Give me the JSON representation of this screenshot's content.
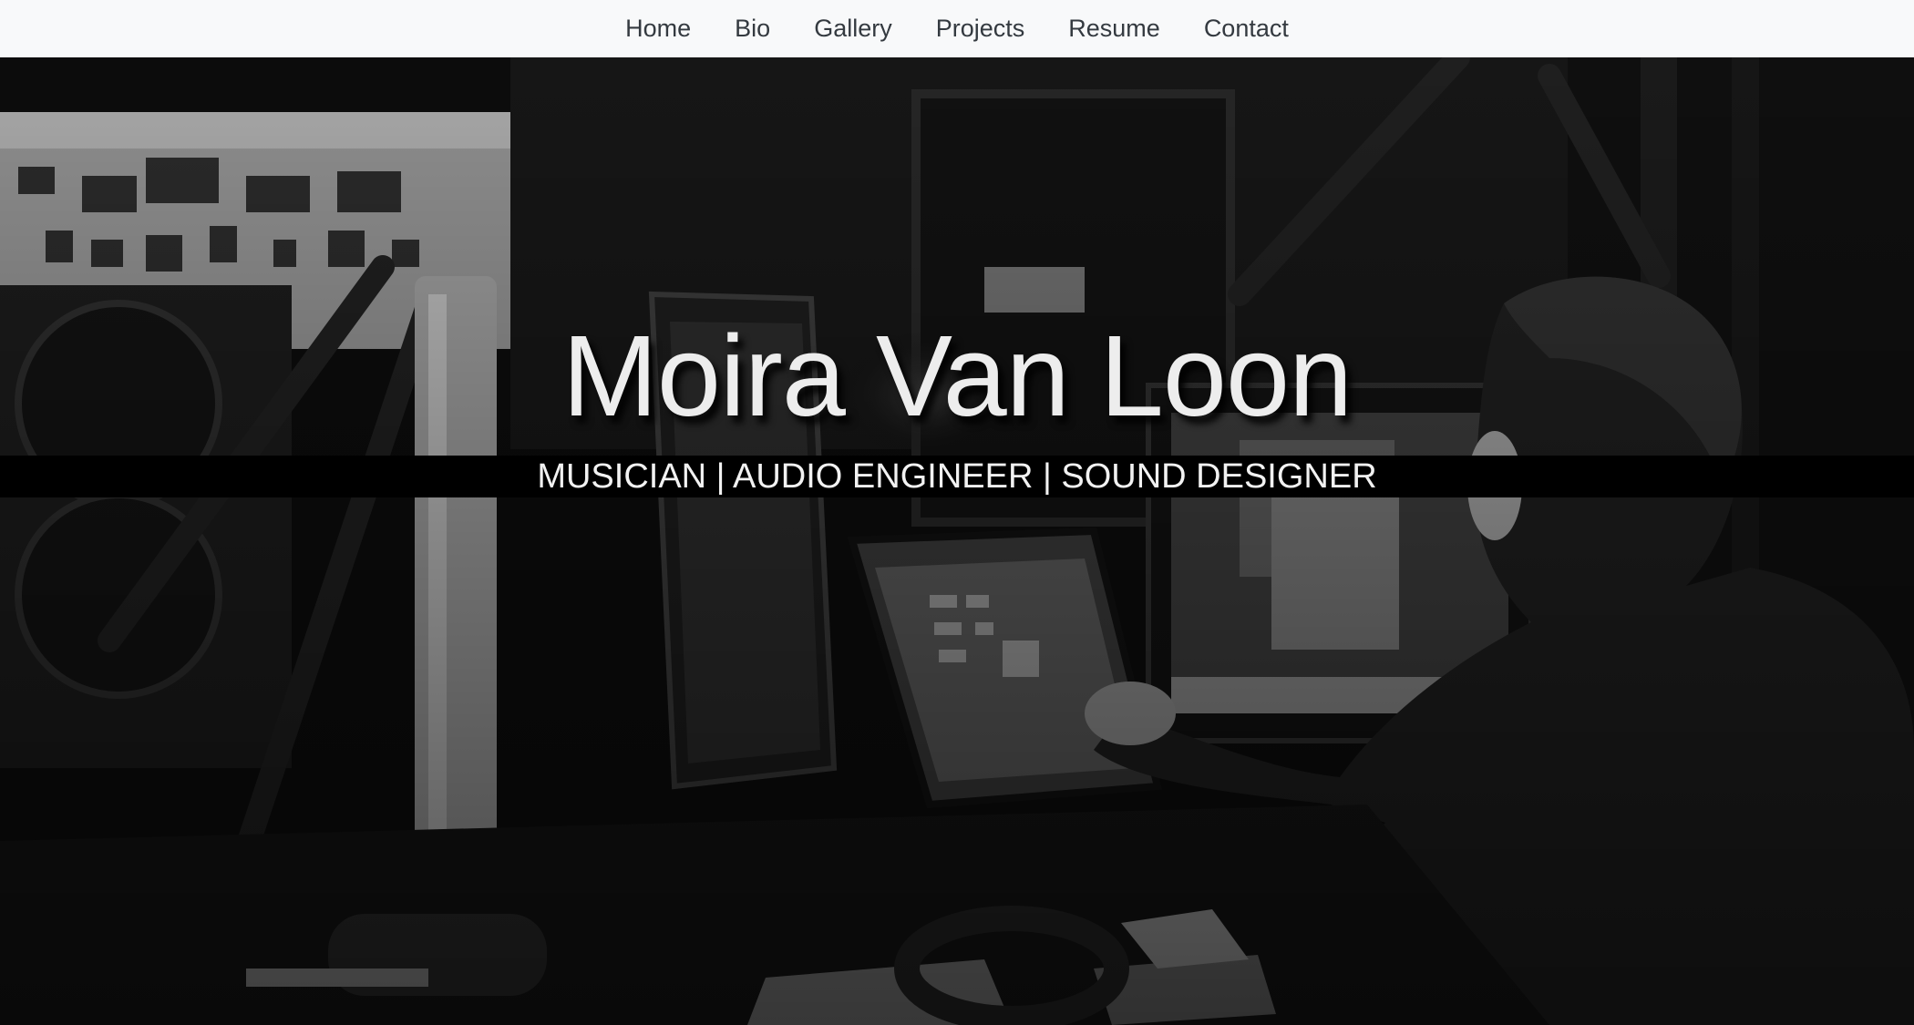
{
  "nav": {
    "items": [
      {
        "label": "Home"
      },
      {
        "label": "Bio"
      },
      {
        "label": "Gallery"
      },
      {
        "label": "Projects"
      },
      {
        "label": "Resume"
      },
      {
        "label": "Contact"
      }
    ]
  },
  "hero": {
    "title": "Moira Van Loon",
    "tagline": "MUSICIAN | AUDIO ENGINEER | SOUND DESIGNER",
    "background": "black-and-white photo of a person working at a radio studio desk with microphones, monitors and a tablet"
  },
  "colors": {
    "navbar_bg": "#f8f9fa",
    "nav_text": "#343a40",
    "hero_text": "#ededed",
    "tagline_band": "#000000"
  }
}
